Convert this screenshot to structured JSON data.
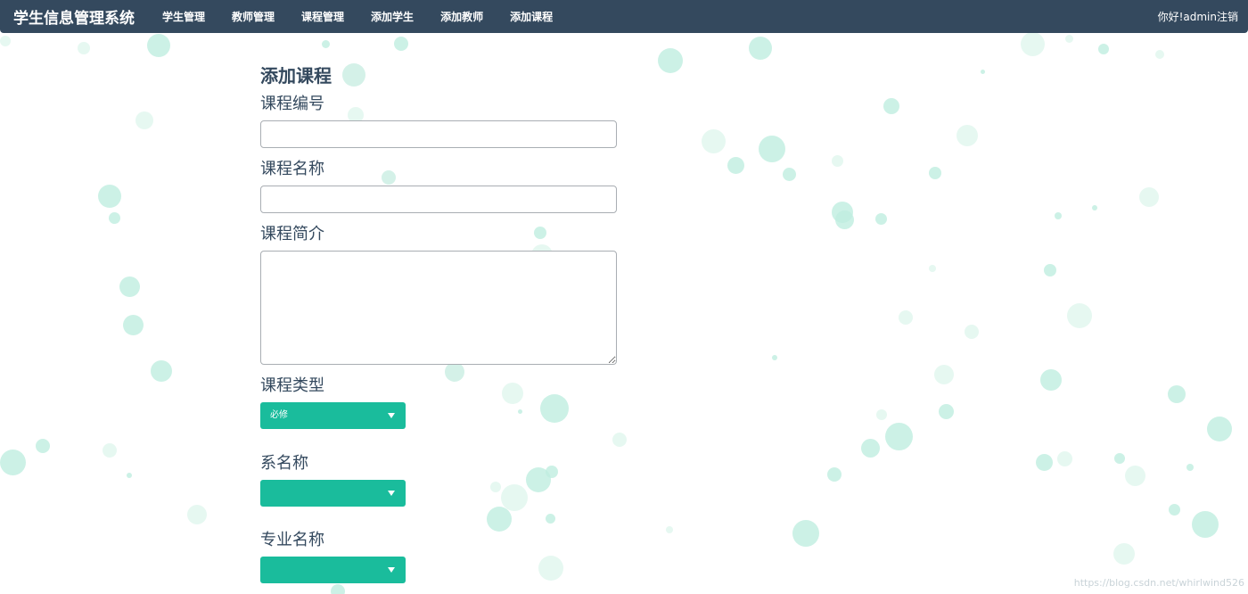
{
  "navbar": {
    "brand": "学生信息管理系统",
    "links": [
      "学生管理",
      "教师管理",
      "课程管理",
      "添加学生",
      "添加教师",
      "添加课程"
    ],
    "greeting": "你好!admin",
    "logout_label": "注销",
    "background_color": "#34495e"
  },
  "form": {
    "title": "添加课程",
    "course_id": {
      "label": "课程编号",
      "value": ""
    },
    "course_name": {
      "label": "课程名称",
      "value": ""
    },
    "course_intro": {
      "label": "课程简介",
      "value": ""
    },
    "course_type": {
      "label": "课程类型",
      "selected": "必修"
    },
    "department": {
      "label": "系名称",
      "selected": ""
    },
    "major": {
      "label": "专业名称",
      "selected": ""
    },
    "select_color": "#1abc9c"
  },
  "watermark": "https://blog.csdn.net/whirlwind526"
}
